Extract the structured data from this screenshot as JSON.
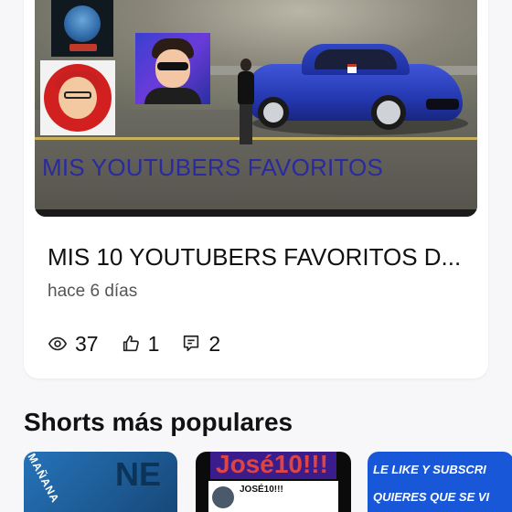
{
  "video_card": {
    "thumbnail_text": "MIS YOUTUBERS FAVORITOS",
    "title": "MIS 10 YOUTUBERS FAVORITOS D...",
    "date": "hace 6 días",
    "views": "37",
    "likes": "1",
    "comments": "2"
  },
  "section": {
    "title": "Shorts más populares"
  },
  "shorts": [
    {
      "text_side": "MAÑANA",
      "text_big": "NE"
    },
    {
      "banner": "José10!!!",
      "name": "JOSÉ10!!!"
    },
    {
      "line1": "LE LIKE Y SUBSCRI",
      "line2": "QUIERES QUE SE VI"
    }
  ],
  "colors": {
    "accent_blue": "#1957d9",
    "thumbnail_text": "#2a2aa0",
    "text_primary": "#111111",
    "text_secondary": "#555555"
  },
  "icons": [
    "eye-icon",
    "thumbs-up-icon",
    "comment-icon"
  ]
}
